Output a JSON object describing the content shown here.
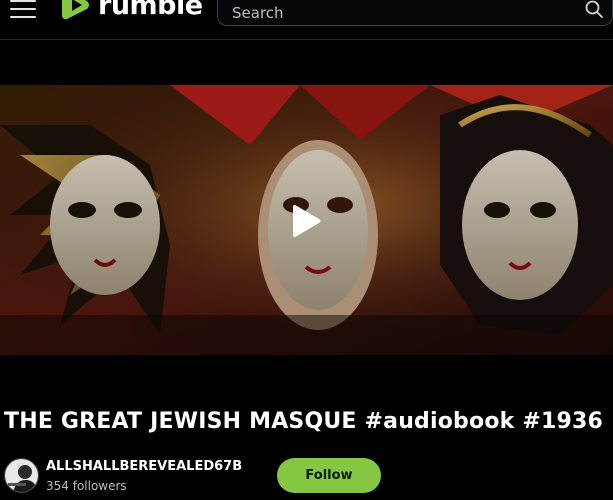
{
  "header": {
    "logo_text": "rumble",
    "search_placeholder": "Search"
  },
  "video": {
    "title": "THE GREAT JEWISH MASQUE #audiobook #1936"
  },
  "channel": {
    "name": "ALLSHALLBEREVEALED67B",
    "followers": "354 followers",
    "follow_label": "Follow"
  },
  "colors": {
    "brand_green": "#85c742",
    "background": "#000000"
  }
}
